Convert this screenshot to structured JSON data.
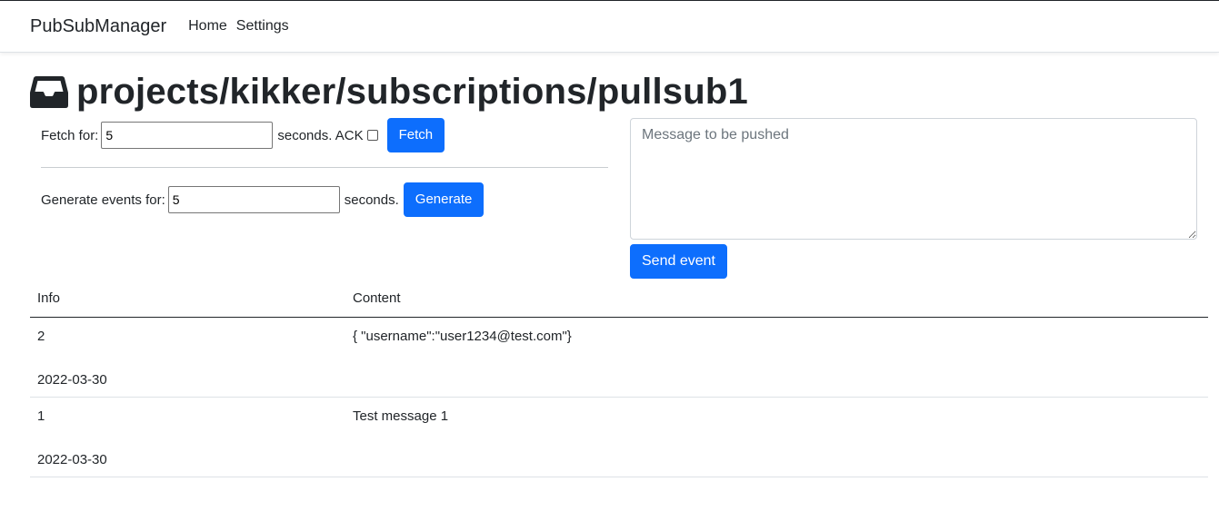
{
  "navbar": {
    "brand": "PubSubManager",
    "links": [
      "Home",
      "Settings"
    ]
  },
  "page": {
    "icon": "inbox-icon",
    "title": "projects/kikker/subscriptions/pullsub1"
  },
  "fetch": {
    "label": "Fetch for:",
    "value": "5",
    "suffix": "seconds. ACK",
    "ack_checked": false,
    "button": "Fetch"
  },
  "generate": {
    "label": "Generate events for:",
    "value": "5",
    "suffix": "seconds.",
    "button": "Generate"
  },
  "push": {
    "placeholder": "Message to be pushed",
    "button": "Send event"
  },
  "table": {
    "headers": [
      "Info",
      "Content"
    ],
    "rows": [
      {
        "id": "2",
        "date": "2022-03-30",
        "content": "{ \"username\":\"user1234@test.com\"}"
      },
      {
        "id": "1",
        "date": "2022-03-30",
        "content": "Test message 1"
      }
    ]
  },
  "colors": {
    "primary": "#0d6efd",
    "text": "#212529"
  }
}
